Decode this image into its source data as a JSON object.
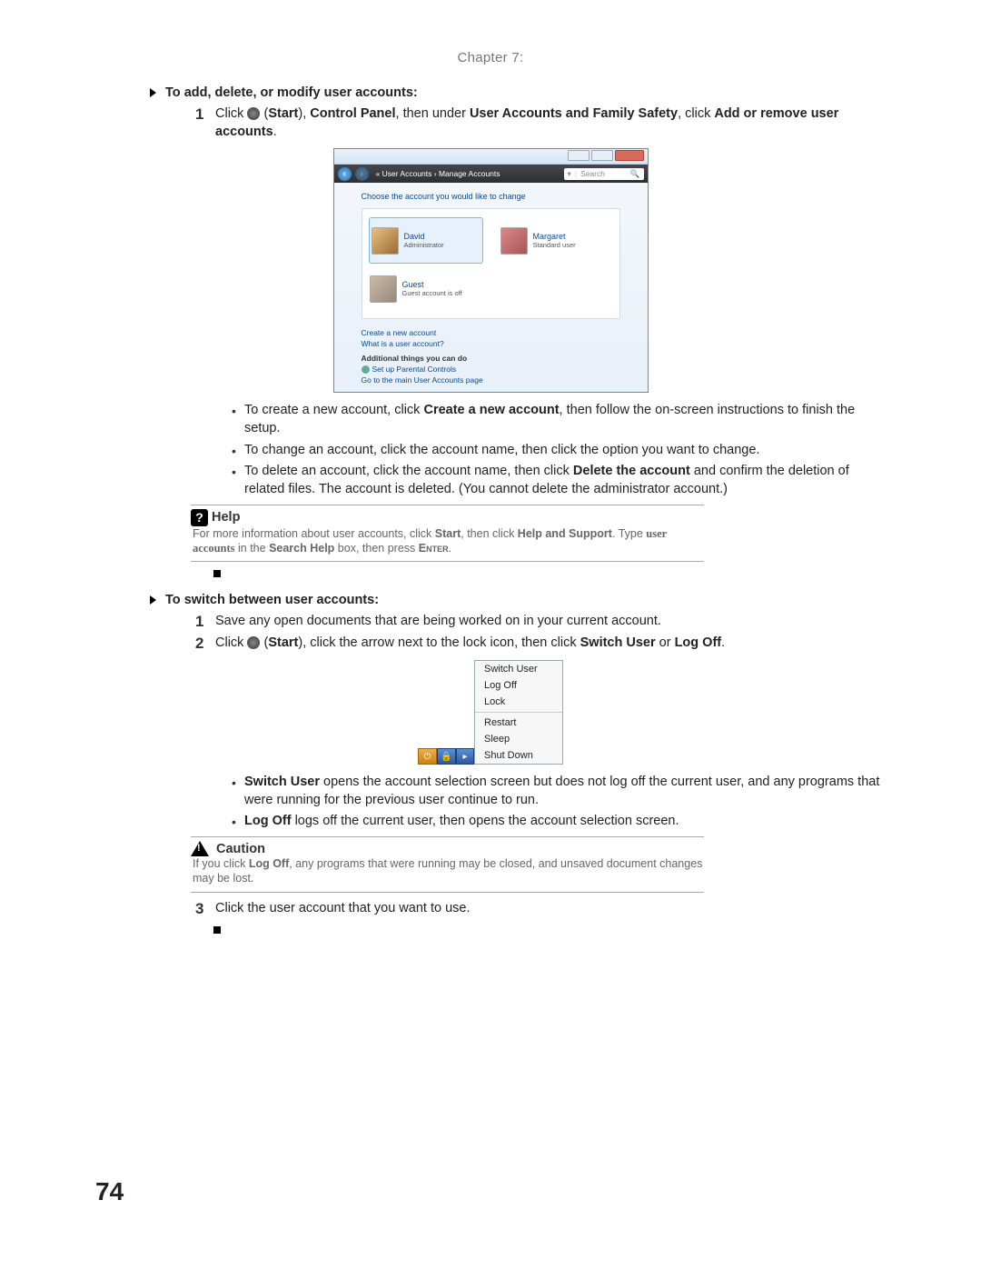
{
  "chapter": "Chapter 7:",
  "page_number": "74",
  "section1": {
    "heading": "To add, delete, or modify user accounts:",
    "step1_num": "1",
    "step1_a": "Click ",
    "step1_b": " (",
    "step1_start": "Start",
    "step1_c": "), ",
    "step1_cp": "Control Panel",
    "step1_d": ", then under ",
    "step1_uafs": "User Accounts and Family Safety",
    "step1_e": ", click ",
    "step1_add": "Add or remove user accounts",
    "step1_f": "."
  },
  "vista": {
    "crumb": "« User Accounts › Manage Accounts",
    "search_placeholder": "Search",
    "prompt": "Choose the account you would like to change",
    "david": "David",
    "david_role": "Administrator",
    "margaret": "Margaret",
    "margaret_role": "Standard user",
    "guest": "Guest",
    "guest_role": "Guest account is off",
    "link_create": "Create a new account",
    "link_what": "What is a user account?",
    "link_add_hd": "Additional things you can do",
    "link_pc": "Set up Parental Controls",
    "link_main": "Go to the main User Accounts page"
  },
  "bullets1": {
    "b1a": "To create a new account, click ",
    "b1b": "Create a new account",
    "b1c": ", then follow the on-screen instructions to finish the setup.",
    "b2": "To change an account, click the account name, then click the option you want to change.",
    "b3a": "To delete an account, click the account name, then click ",
    "b3b": "Delete the account",
    "b3c": " and confirm the deletion of related files. The account is deleted. (You cannot delete the administrator account.)"
  },
  "help": {
    "title": "Help",
    "l1a": "For more information about user accounts, click ",
    "l1b": "Start",
    "l1c": ", then click ",
    "l1d": "Help and Support",
    "l1e": ". Type ",
    "l1f": "user accounts",
    "l1g": " in the ",
    "l1h": "Search Help",
    "l1i": " box, then press ",
    "l1j": "Enter",
    "l1k": "."
  },
  "section2": {
    "heading": "To switch between user accounts:",
    "step1_num": "1",
    "step1": "Save any open documents that are being worked on in your current account.",
    "step2_num": "2",
    "step2_a": "Click ",
    "step2_b": " (",
    "step2_start": "Start",
    "step2_c": "), click the arrow next to the lock icon, then click ",
    "step2_su": "Switch User",
    "step2_d": " or ",
    "step2_lo": "Log Off",
    "step2_e": "."
  },
  "menu": {
    "m1": "Switch User",
    "m2": "Log Off",
    "m3": "Lock",
    "m4": "Restart",
    "m5": "Sleep",
    "m6": "Shut Down"
  },
  "bullets2": {
    "b1a": "Switch User",
    "b1b": " opens the account selection screen but does not log off the current user, and any programs that were running for the previous user continue to run.",
    "b2a": "Log Off",
    "b2b": " logs off the current user, then opens the account selection screen."
  },
  "caution": {
    "title": "Caution",
    "a": "If you click ",
    "b": "Log Off",
    "c": ", any programs that were running may be closed, and unsaved document changes may be lost."
  },
  "step3_num": "3",
  "step3": "Click the user account that you want to use."
}
